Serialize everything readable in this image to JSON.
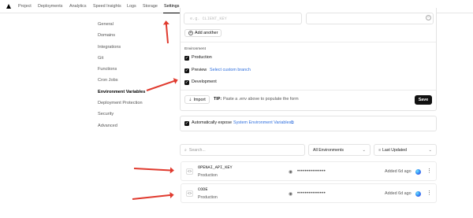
{
  "top_nav": {
    "items": [
      "Project",
      "Deployments",
      "Analytics",
      "Speed Insights",
      "Logs",
      "Storage",
      "Settings"
    ],
    "active": "Settings"
  },
  "sidebar": {
    "items": [
      "General",
      "Domains",
      "Integrations",
      "Git",
      "Functions",
      "Cron Jobs",
      "Environment Variables",
      "Deployment Protection",
      "Security",
      "Advanced"
    ],
    "active": "Environment Variables"
  },
  "form": {
    "key_placeholder": "e.g. CLIENT_KEY",
    "add_another": "Add another",
    "environment_heading": "Environment",
    "environments": [
      {
        "label": "Production",
        "checked": true
      },
      {
        "label": "Preview",
        "checked": true,
        "link": "Select custom branch"
      },
      {
        "label": "Development",
        "checked": true
      }
    ],
    "import_label": "Import",
    "tip_label": "TIP:",
    "tip_text": "Paste a .env above to populate the form",
    "save_label": "Save"
  },
  "auto_expose": {
    "text": "Automatically expose",
    "link": "System Environment Variables",
    "checked": true
  },
  "filters": {
    "search_placeholder": "Search...",
    "env_select": "All Environments",
    "sort_select": "Last Updated"
  },
  "variables": [
    {
      "name": "OPENAI_API_KEY",
      "env": "Production",
      "masked": "•••••••••••••••",
      "added": "Added 6d ago"
    },
    {
      "name": "CODE",
      "env": "Production",
      "masked": "•••••••••••••••",
      "added": "Added 6d ago"
    }
  ],
  "colors": {
    "accent_link": "#2f6fde",
    "annotation_arrow": "#e03a2e",
    "primary_button": "#111111"
  }
}
